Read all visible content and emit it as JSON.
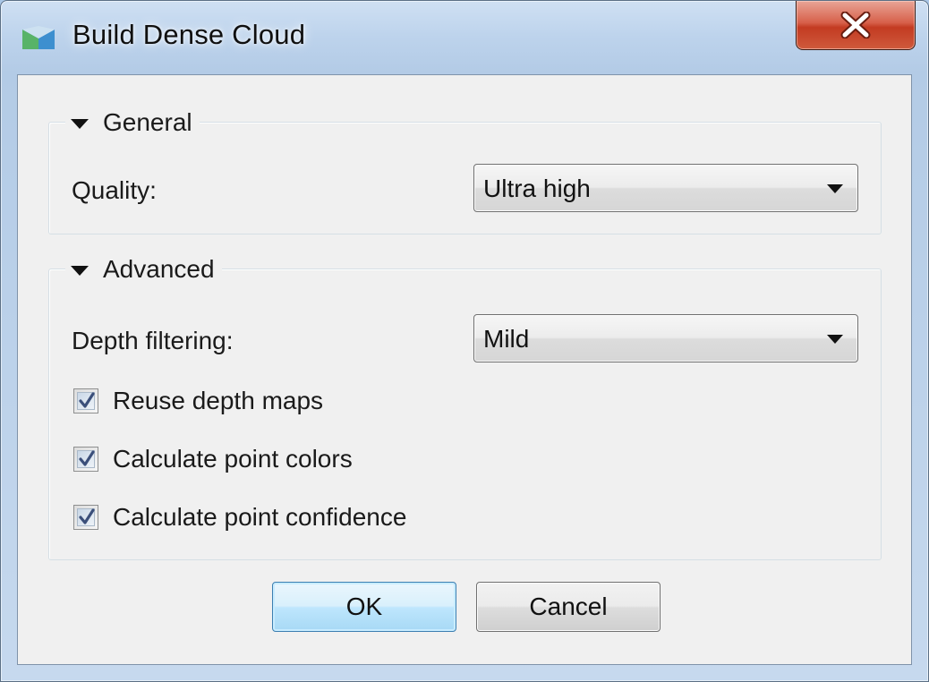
{
  "window": {
    "title": "Build Dense Cloud",
    "app_icon": "photoscan-app-icon",
    "close_icon": "close-x-icon"
  },
  "general": {
    "header": "General",
    "quality_label": "Quality:",
    "quality_value": "Ultra high"
  },
  "advanced": {
    "header": "Advanced",
    "depth_filtering_label": "Depth filtering:",
    "depth_filtering_value": "Mild",
    "checkboxes": [
      {
        "label": "Reuse depth maps",
        "checked": true
      },
      {
        "label": "Calculate point colors",
        "checked": true
      },
      {
        "label": "Calculate point confidence",
        "checked": true
      }
    ]
  },
  "buttons": {
    "ok_label": "OK",
    "cancel_label": "Cancel"
  },
  "colors": {
    "client_background": "#f0f0f0",
    "close_button_red": "#c33b22",
    "default_button_blue": "#3c7fb1"
  }
}
